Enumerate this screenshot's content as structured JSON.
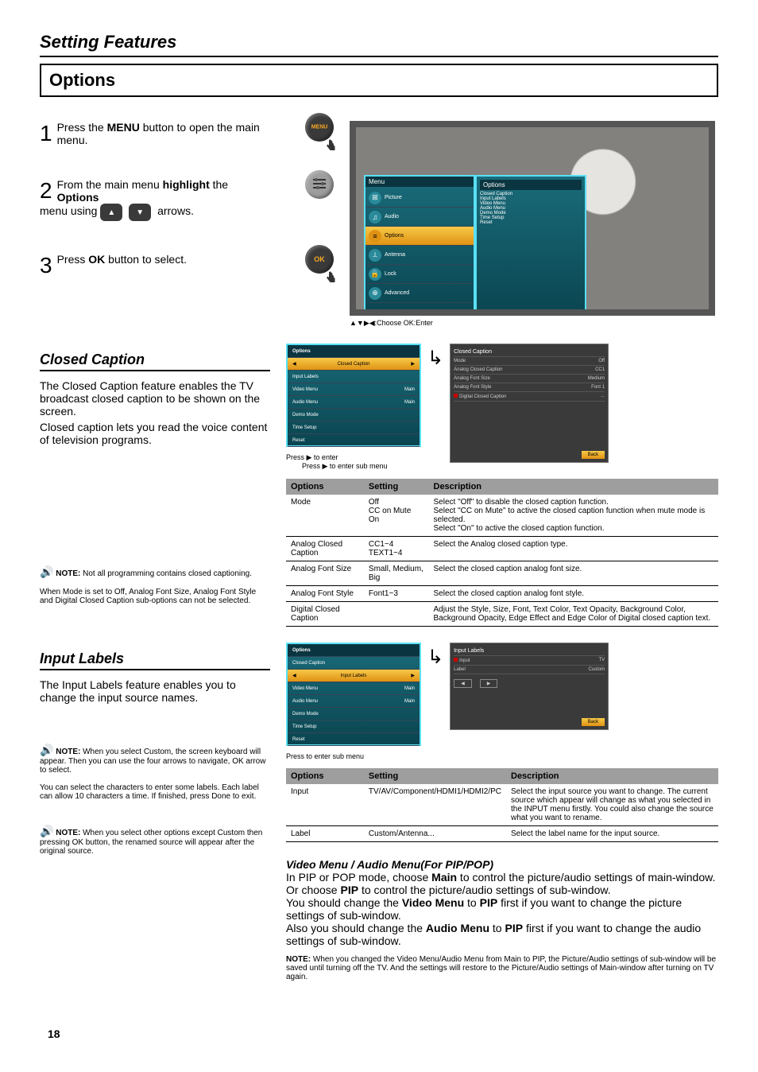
{
  "header": {
    "section_title": "Setting Features",
    "options_heading": "Options"
  },
  "steps": {
    "s1_num": "1",
    "s1_text_a": "Press the ",
    "s1_bold": "MENU",
    "s1_text_b": " button to open the main menu.",
    "menu_btn": "MENU",
    "s2_num": "2",
    "s2_text_a": "From the main menu ",
    "s2_bold_a": "highlight",
    "s2_text_b": " the ",
    "s2_bold_b": "Options",
    "s2_text_c": " menu using ",
    "s2_arrows": "▲▼",
    "s2_text_d": " arrows.",
    "s3_num": "3",
    "s3_text_a": "Press ",
    "s3_bold": "OK",
    "s3_text_b": " button to select.",
    "ok_btn": "OK"
  },
  "main_osd": {
    "title": "Menu",
    "items": [
      "Picture",
      "Audio",
      "Options",
      "Antenna",
      "Lock",
      "Advanced"
    ],
    "options_idx": 2,
    "sub_options": [
      "Closed Caption",
      "Input Labels",
      "Video Menu",
      "Audio Menu",
      "Demo Mode",
      "Time Setup",
      "Reset"
    ],
    "legend": "Choose    OK:Enter"
  },
  "closed_caption": {
    "title": "Closed Caption",
    "desc1": "The Closed Caption feature enables the TV broadcast closed caption to be shown on the screen.",
    "desc2": "Closed caption lets you read the voice content of television programs.",
    "note_icon": "🔊",
    "note_title": "NOTE:",
    "note1": "Not all programming contains closed captioning.",
    "note2": "When Mode is set to Off, Analog Font Size, Analog Font Style and Digital Closed Caption sub-options can not be selected.",
    "arrow_text_a": "Press    to enter",
    "arrow_text_b": "Press    to enter sub menu",
    "sub_panel_items": [
      {
        "label": "Closed Caption",
        "value": ""
      },
      {
        "label": "Input Labels",
        "value": ""
      },
      {
        "label": "Video Menu",
        "value": "Main"
      },
      {
        "label": "Audio Menu",
        "value": "Main"
      },
      {
        "label": "Demo Mode",
        "value": ""
      },
      {
        "label": "Time Setup",
        "value": ""
      },
      {
        "label": "Reset",
        "value": ""
      }
    ],
    "sub_title": "Options",
    "dark_title": "Closed Caption",
    "dark_items": [
      {
        "label": "Mode",
        "value": "Off"
      },
      {
        "label": "Analog Closed Caption",
        "value": "CC1"
      },
      {
        "label": "Analog Font Size",
        "value": "Medium"
      },
      {
        "label": "Analog Font Style",
        "value": "Font 1"
      },
      {
        "label": "Digital Closed Caption",
        "value": "..."
      }
    ],
    "back_label": "Back",
    "table_header": [
      "Options",
      "Setting",
      "Description"
    ],
    "table_rows": [
      {
        "opt": "Mode",
        "set": "Off\nCC on Mute\nOn",
        "desc": "Select \"Off\" to disable the closed caption function.\nSelect \"CC on Mute\" to active the closed caption function when mute mode is selected.\nSelect \"On\" to active the closed caption function."
      },
      {
        "opt": "Analog Closed Caption",
        "set": "CC1~4\nTEXT1~4",
        "desc": "Select the Analog closed caption type."
      },
      {
        "opt": "Analog Font Size",
        "set": "Small, Medium, Big",
        "desc": "Select the closed caption analog font size."
      },
      {
        "opt": "Analog Font Style",
        "set": "Font1~3",
        "desc": "Select the closed caption analog font style."
      },
      {
        "opt": "Digital Closed Caption",
        "set": "",
        "desc": "Adjust the Style, Size, Font, Text Color, Text Opacity, Background Color, Background Opacity, Edge Effect and Edge Color of Digital closed caption text."
      }
    ]
  },
  "input_labels": {
    "title": "Input Labels",
    "desc1": "The Input Labels feature enables you to change the input source names.",
    "note_title": "NOTE:",
    "note1": "When you select Custom, the screen keyboard will appear. Then you can use the four arrows to navigate, OK arrow to select.",
    "note2": "You can select the characters to enter some labels. Each label can allow 10 characters a time. If finished, press Done to exit.",
    "note3": "When you select other options except Custom then pressing OK button, the renamed source will appear after the original source.",
    "sub_items": [
      {
        "label": "Closed Caption",
        "value": ""
      },
      {
        "label": "Input Labels",
        "value": ""
      },
      {
        "label": "Video Menu",
        "value": "Main"
      },
      {
        "label": "Audio Menu",
        "value": "Main"
      },
      {
        "label": "Demo Mode",
        "value": ""
      },
      {
        "label": "Time Setup",
        "value": ""
      },
      {
        "label": "Reset",
        "value": ""
      }
    ],
    "sub_title": "Options",
    "dark_title": "Input Labels",
    "dark_items": [
      {
        "label": "Input",
        "value": "TV"
      },
      {
        "label": "Label",
        "value": "Custom"
      }
    ],
    "back_label": "Back",
    "arrow_text": "Press    to enter sub menu",
    "table_header": [
      "Options",
      "Setting",
      "Description"
    ],
    "table_rows": [
      {
        "opt": "Input",
        "set": "TV/AV/Component/HDMI1/HDMI2/PC",
        "desc": "Select the input source you want to change. The current source which appear will change as what you selected in the INPUT menu firstly. You could also change the source what you want to rename."
      },
      {
        "opt": "Label",
        "set": "Custom/Antenna...",
        "desc": "Select the label name for the input source."
      }
    ]
  },
  "video_audio": {
    "title": "Video Menu / Audio Menu(For PIP/POP)",
    "desc1_a": "In PIP or POP mode, choose ",
    "desc1_bold_a": "Main",
    "desc1_b": " to control the picture/audio settings of main-window.",
    "desc2_a": "Or choose ",
    "desc2_bold_a": "PIP",
    "desc2_b": " to control the picture/audio settings of sub-window.",
    "desc3_a": "You should change the ",
    "desc3_bold_a": "Video Menu",
    "desc3_b": " to ",
    "desc3_bold_b": "PIP",
    "desc3_c": " first if you want to change the picture settings of sub-window.",
    "desc4_a": "Also you should change the ",
    "desc4_bold_a": "Audio Menu",
    "desc4_b": " to ",
    "desc4_bold_b": "PIP",
    "desc4_c": " first if you want to change the audio settings of sub-window.",
    "note_title": "NOTE:",
    "note": "When you changed the Video Menu/Audio Menu from Main to PIP, the Picture/Audio settings of sub-window will be saved until turning off the TV. And the settings will restore to the Picture/Audio settings of Main-window after turning on TV again."
  },
  "page_number": "18"
}
